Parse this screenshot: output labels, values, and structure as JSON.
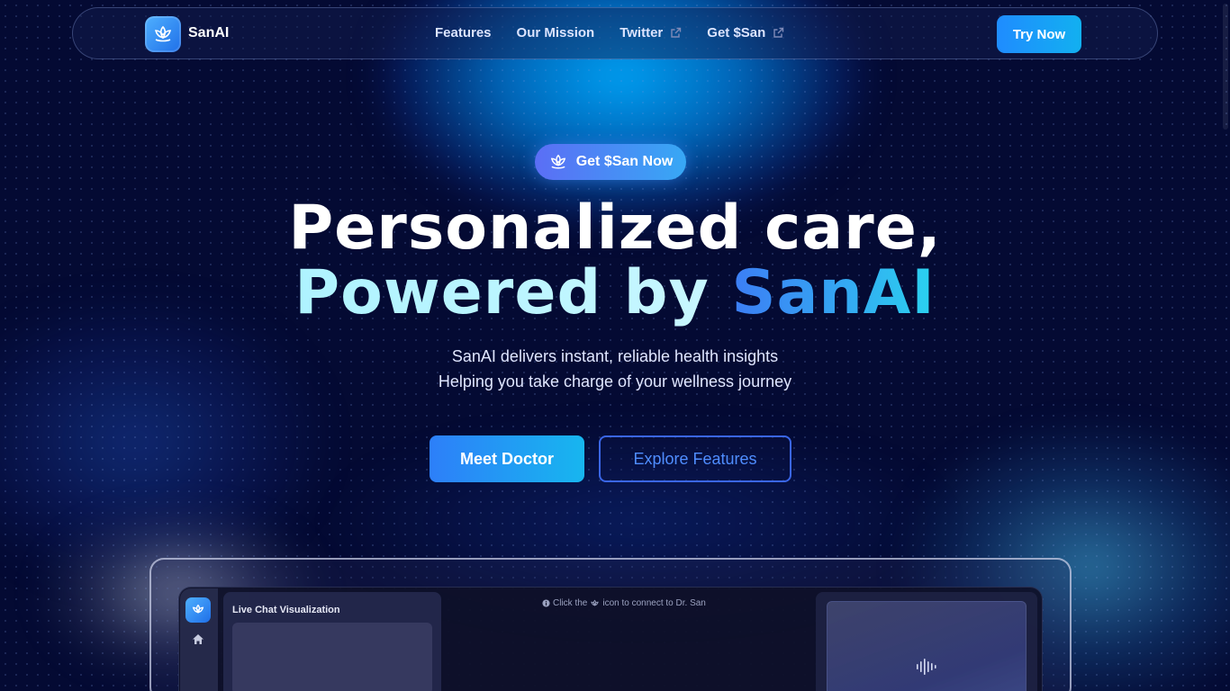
{
  "nav": {
    "brand": "SanAI",
    "links": [
      {
        "label": "Features",
        "external": false
      },
      {
        "label": "Our Mission",
        "external": false
      },
      {
        "label": "Twitter",
        "external": true
      },
      {
        "label": "Get $San",
        "external": true
      }
    ],
    "cta": "Try Now"
  },
  "hero": {
    "pill": "Get $San Now",
    "headline_line1": "Personalized care,",
    "headline_line2_prefix": "Powered by ",
    "headline_line2_brand": "SanAI",
    "sub1": "SanAI delivers instant, reliable health insights",
    "sub2": "Helping you take charge of your wellness journey",
    "primary_button": "Meet Doctor",
    "secondary_button": "Explore Features"
  },
  "preview": {
    "chat_title": "Live Chat Visualization",
    "hint_prefix": "Click the",
    "hint_suffix": "icon to connect to Dr. San"
  },
  "colors": {
    "background": "#040a33",
    "accent_blue": "#1f8cff",
    "accent_cyan": "#17b6ef",
    "outline_blue": "#3a66e8"
  },
  "icons": [
    "lotus-icon",
    "external-link-icon",
    "home-icon",
    "info-icon",
    "audio-wave-icon"
  ]
}
